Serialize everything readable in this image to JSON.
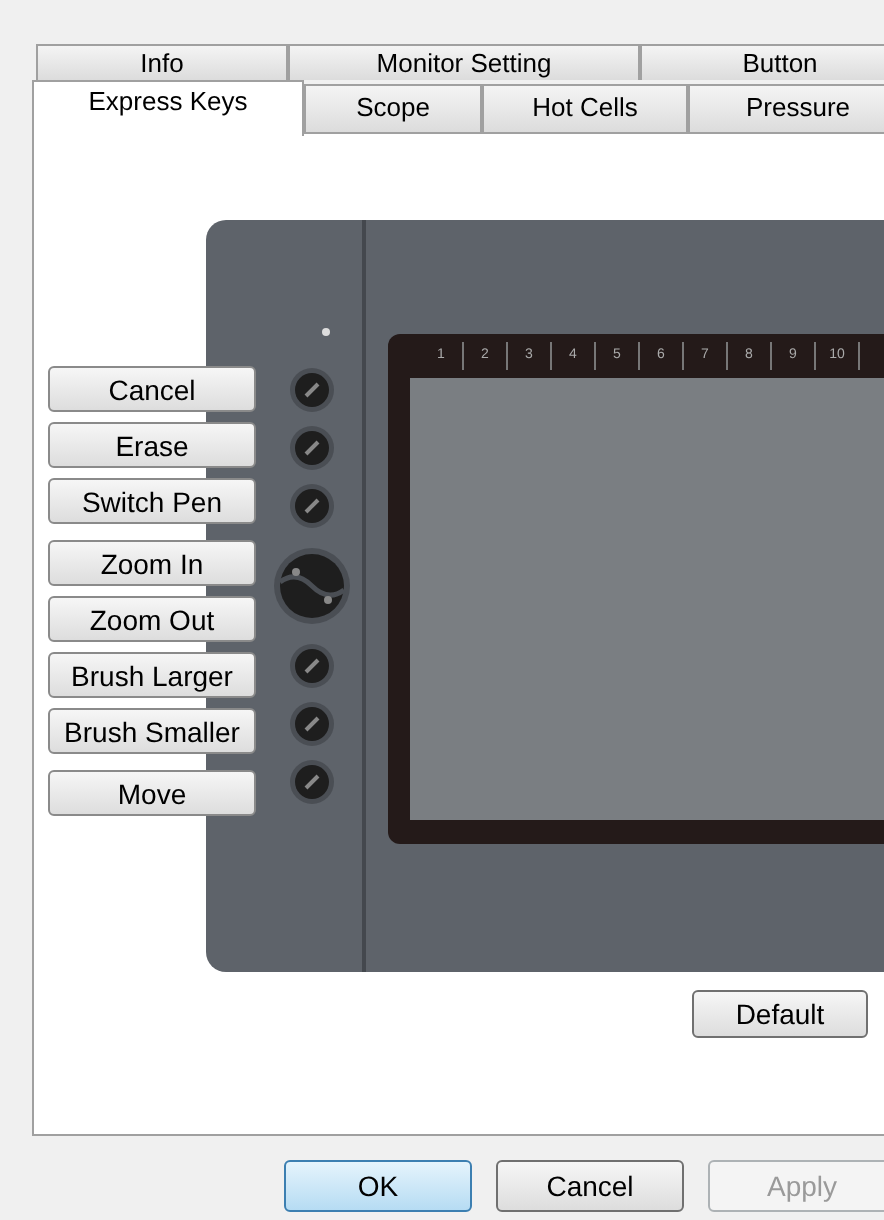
{
  "tab_rows": [
    [
      {
        "label": "Info",
        "selected": false
      },
      {
        "label": "Monitor Setting",
        "selected": false
      },
      {
        "label": "Button",
        "selected": false
      }
    ],
    [
      {
        "label": "Express Keys",
        "selected": true
      },
      {
        "label": "Scope",
        "selected": false
      },
      {
        "label": "Hot Cells",
        "selected": false
      },
      {
        "label": "Pressure",
        "selected": false
      }
    ]
  ],
  "express_keys": [
    "Cancel",
    "Erase",
    "Switch Pen",
    "Zoom In",
    "Zoom Out",
    "Brush Larger",
    "Brush Smaller",
    "Move"
  ],
  "ruler_labels": [
    "1",
    "2",
    "3",
    "4",
    "5",
    "6",
    "7",
    "8",
    "9",
    "10"
  ],
  "default_button": "Default",
  "buttons": [
    {
      "label": "OK",
      "kind": "default",
      "disabled": false
    },
    {
      "label": "Cancel",
      "kind": "normal",
      "disabled": false
    },
    {
      "label": "Apply",
      "kind": "normal",
      "disabled": true
    }
  ]
}
